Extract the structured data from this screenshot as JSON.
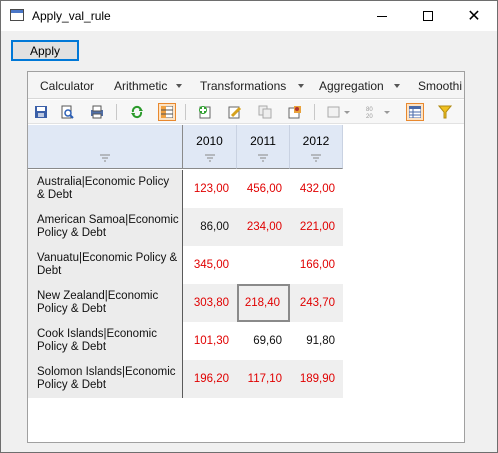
{
  "window": {
    "title": "Apply_val_rule",
    "close_glyph": "✕"
  },
  "apply_button": {
    "label": "Apply"
  },
  "menu": [
    {
      "label": "Calculator",
      "has_arrow": false
    },
    {
      "label": "Arithmetic",
      "has_arrow": true
    },
    {
      "label": "Transformations",
      "has_arrow": true
    },
    {
      "label": "Aggregation",
      "has_arrow": true
    },
    {
      "label": "Smoothi",
      "has_arrow": false
    }
  ],
  "toolbar": [
    "save-icon",
    "print-preview-icon",
    "print-icon",
    "refresh-icon",
    "table-view-icon",
    "add-series-icon",
    "edit-series-icon",
    "copy-series-icon",
    "series-properties-icon",
    "chart-options-icon",
    "number-format-icon",
    "grid-layout-icon",
    "filter-icon"
  ],
  "colors": {
    "accent": "#0078d7",
    "negative_value": "#e00000",
    "header_bg": "#e0e8f5"
  },
  "table": {
    "columns": [
      "2010",
      "2011",
      "2012"
    ],
    "rows": [
      {
        "label_line1": "Australia|Economic Policy",
        "label_line2": "& Debt",
        "values": [
          "123,00",
          "456,00",
          "432,00"
        ],
        "colors": [
          "red",
          "red",
          "red"
        ]
      },
      {
        "label_line1": "American Samoa|Economic",
        "label_line2": "Policy & Debt",
        "values": [
          "86,00",
          "234,00",
          "221,00"
        ],
        "colors": [
          "black",
          "red",
          "red"
        ]
      },
      {
        "label_line1": "Vanuatu|Economic Policy &",
        "label_line2": "Debt",
        "values": [
          "345,00",
          "",
          "166,00"
        ],
        "colors": [
          "red",
          "red",
          "red"
        ]
      },
      {
        "label_line1": "New Zealand|Economic",
        "label_line2": "Policy & Debt",
        "values": [
          "303,80",
          "218,40",
          "243,70"
        ],
        "colors": [
          "red",
          "red",
          "red"
        ]
      },
      {
        "label_line1": "Cook Islands|Economic",
        "label_line2": "Policy & Debt",
        "values": [
          "101,30",
          "69,60",
          "91,80"
        ],
        "colors": [
          "red",
          "black",
          "black"
        ]
      },
      {
        "label_line1": "Solomon Islands|Economic",
        "label_line2": "Policy & Debt",
        "values": [
          "196,20",
          "117,10",
          "189,90"
        ],
        "colors": [
          "red",
          "red",
          "red"
        ]
      }
    ]
  }
}
